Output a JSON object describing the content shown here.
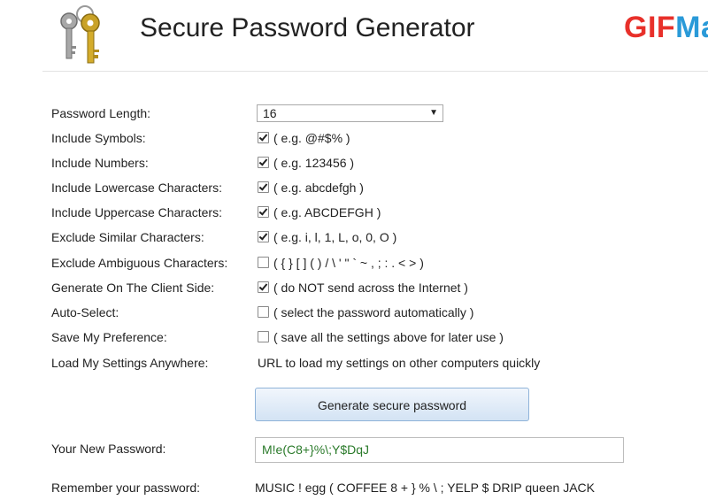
{
  "header": {
    "title": "Secure Password Generator",
    "brand_part1": "GIF",
    "brand_part2": "Ma",
    "logo_icon": "keys-icon"
  },
  "form": {
    "length": {
      "label": "Password Length:",
      "value": "16",
      "arrow": "▼"
    },
    "symbols": {
      "label": "Include Symbols:",
      "checked": true,
      "hint": "( e.g. @#$% )"
    },
    "numbers": {
      "label": "Include Numbers:",
      "checked": true,
      "hint": "( e.g. 123456 )"
    },
    "lowercase": {
      "label": "Include Lowercase Characters:",
      "checked": true,
      "hint": "( e.g. abcdefgh )"
    },
    "uppercase": {
      "label": "Include Uppercase Characters:",
      "checked": true,
      "hint": "( e.g. ABCDEFGH )"
    },
    "similar": {
      "label": "Exclude Similar Characters:",
      "checked": true,
      "hint": "( e.g. i, l, 1, L, o, 0, O )"
    },
    "ambiguous": {
      "label": "Exclude Ambiguous Characters:",
      "checked": false,
      "hint": "( { } [ ] ( ) / \\ ' \" ` ~ , ; : . < > )"
    },
    "client_side": {
      "label": "Generate On The Client Side:",
      "checked": true,
      "hint": "( do NOT send across the Internet )"
    },
    "auto_select": {
      "label": "Auto-Select:",
      "checked": false,
      "hint": "( select the password automatically )"
    },
    "save_pref": {
      "label": "Save My Preference:",
      "checked": false,
      "hint": "( save all the settings above for later use )"
    },
    "load_settings": {
      "label": "Load My Settings Anywhere:",
      "text": "URL to load my settings on other computers quickly"
    }
  },
  "actions": {
    "generate_label": "Generate secure password"
  },
  "result": {
    "password_label": "Your New Password:",
    "password": "M!e(C8+}%\\;Y$DqJ",
    "remember_label": "Remember your password:",
    "mnemonic": "MUSIC ! egg ( COFFEE 8 + } % \\ ; YELP $ DRIP queen JACK"
  }
}
